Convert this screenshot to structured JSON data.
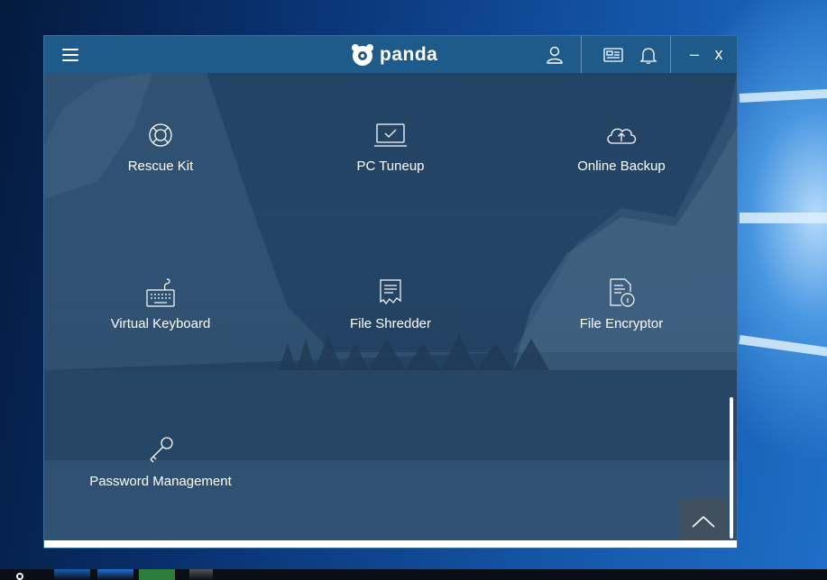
{
  "app": {
    "brand": "panda"
  },
  "titlebar": {
    "icons": [
      "menu-icon",
      "user-icon",
      "news-icon",
      "bell-icon"
    ],
    "minimize": "–",
    "close": "x"
  },
  "tiles": [
    {
      "label": "Rescue Kit",
      "icon": "lifebuoy-icon"
    },
    {
      "label": "PC Tuneup",
      "icon": "laptop-check-icon"
    },
    {
      "label": "Online Backup",
      "icon": "cloud-upload-icon"
    },
    {
      "label": "Virtual Keyboard",
      "icon": "keyboard-icon"
    },
    {
      "label": "File Shredder",
      "icon": "shredder-icon"
    },
    {
      "label": "File Encryptor",
      "icon": "file-lock-icon"
    },
    {
      "label": "Password Management",
      "icon": "key-icon"
    }
  ],
  "colors": {
    "titlebar": "#1e5a8a",
    "content_overlay": "#1f4266",
    "text": "#ffffff"
  }
}
